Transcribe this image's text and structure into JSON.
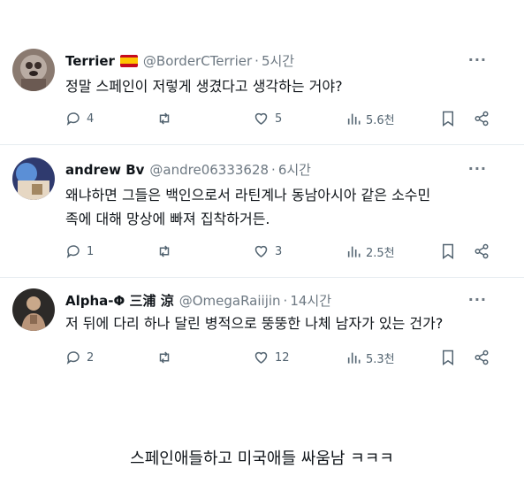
{
  "tweets": [
    {
      "name": "Terrier",
      "flag": "spain-flag",
      "handle": "@BorderCTerrier",
      "dot": "·",
      "time": "5시간",
      "more": "···",
      "text": [
        "정말 스페인이 저렇게 생겼다고 생각하는 거야?"
      ],
      "replies": "4",
      "retweets": "",
      "likes": "5",
      "views": "5.6천"
    },
    {
      "name": "andrew Bv",
      "handle": "@andre06333628",
      "dot": "·",
      "time": "6시간",
      "more": "···",
      "text": [
        "왜냐하면 그들은 백인으로서 라틴계나 동남아시아 같은 소수민",
        "족에 대해 망상에 빠져 집착하거든."
      ],
      "replies": "1",
      "retweets": "",
      "likes": "3",
      "views": "2.5천"
    },
    {
      "name": "Alpha-Φ 三浦 涼",
      "handle": "@OmegaRaiijin",
      "dot": "·",
      "time": "14시간",
      "more": "···",
      "text": [
        "저 뒤에 다리 하나 달린 병적으로 뚱뚱한 나체 남자가 있는 건가?"
      ],
      "replies": "2",
      "retweets": "",
      "likes": "12",
      "views": "5.3천"
    }
  ],
  "caption": "스페인애들하고 미국애들 싸움남 ㅋㅋㅋ",
  "colors": {
    "text": "#0f1419",
    "muted": "#536471",
    "separator": "#e6ecf0"
  }
}
